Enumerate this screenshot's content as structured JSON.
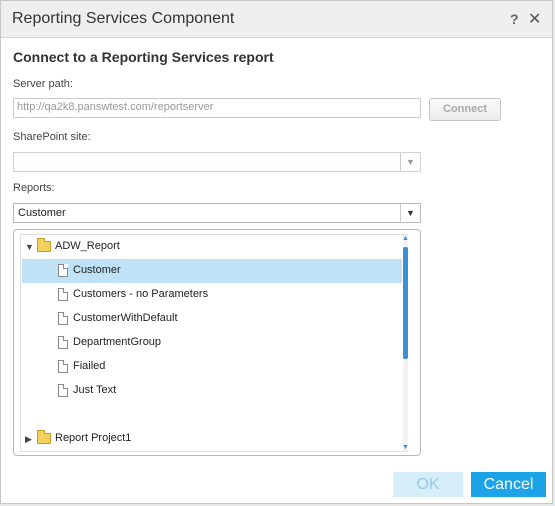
{
  "dialog": {
    "title": "Reporting Services Component",
    "help_icon": "question-mark-icon",
    "close_icon": "close-icon",
    "heading": "Connect to a Reporting Services report"
  },
  "server": {
    "label": "Server path:",
    "value": "http://qa2k8.panswtest.com/reportserver",
    "connect_label": "Connect"
  },
  "sharepoint": {
    "label": "SharePoint site:",
    "value": ""
  },
  "reports": {
    "label": "Reports:",
    "selected": "Customer",
    "tree": [
      {
        "label": "ADW_Report",
        "type": "folder",
        "expanded": true,
        "depth": 0,
        "selected": false
      },
      {
        "label": "Customer",
        "type": "report",
        "depth": 1,
        "selected": true
      },
      {
        "label": "Customers - no Parameters",
        "type": "report",
        "depth": 1,
        "selected": false
      },
      {
        "label": "CustomerWithDefault",
        "type": "report",
        "depth": 1,
        "selected": false
      },
      {
        "label": "DepartmentGroup",
        "type": "report",
        "depth": 1,
        "selected": false
      },
      {
        "label": "Fiailed",
        "type": "report",
        "depth": 1,
        "selected": false
      },
      {
        "label": "Just Text",
        "type": "report",
        "depth": 1,
        "selected": false
      },
      {
        "label": "Report Project1",
        "type": "folder",
        "expanded": false,
        "depth": 0,
        "selected": false
      }
    ]
  },
  "footer": {
    "ok_label": "OK",
    "cancel_label": "Cancel"
  },
  "colors": {
    "accent": "#1ca3e8",
    "selection": "#bfe2f7",
    "scrollbar": "#3b8fd4"
  }
}
